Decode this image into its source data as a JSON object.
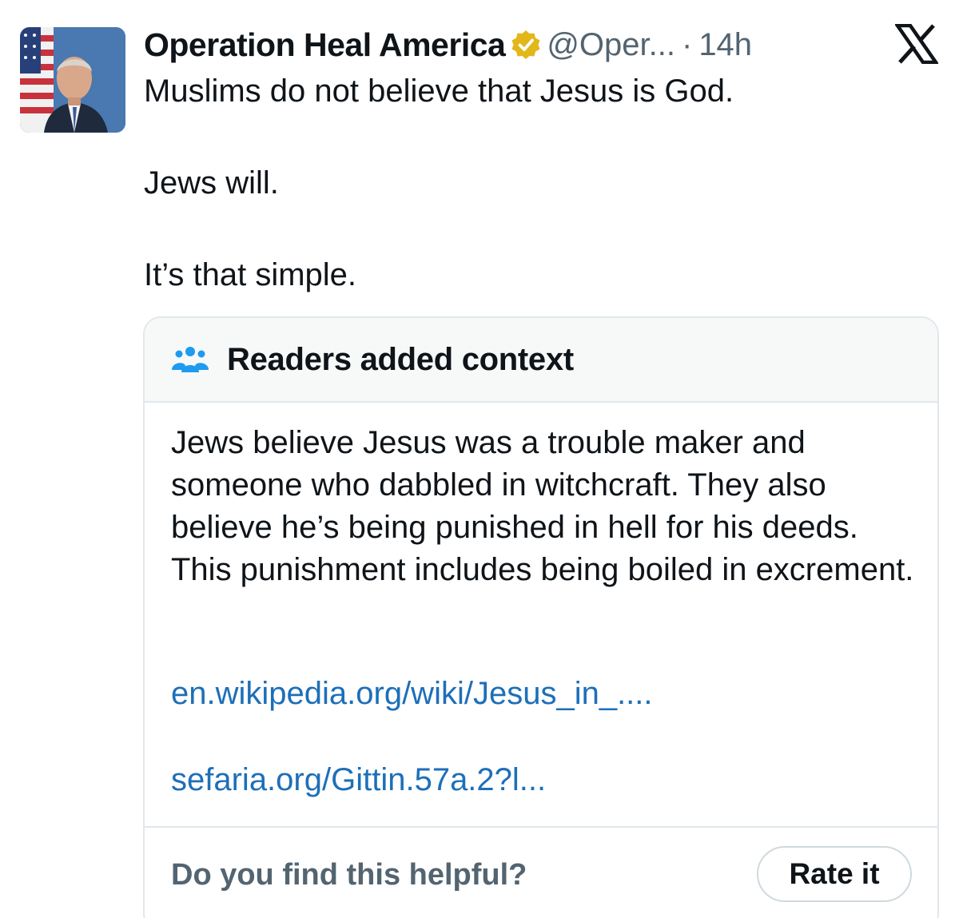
{
  "tweet": {
    "display_name": "Operation Heal America",
    "handle": "@Oper...",
    "separator": "·",
    "time": "14h",
    "lines": [
      "Muslims do not believe that Jesus is God.",
      "Jews will.",
      "It’s that simple."
    ]
  },
  "note": {
    "title": "Readers added context",
    "body": "Jews believe Jesus was a trouble maker and someone who dabbled in witchcraft. They also believe he’s being punished in hell for his deeds. This punishment includes being boiled in excrement.",
    "links": [
      "en.wikipedia.org/wiki/Jesus_in_....",
      "sefaria.org/Gittin.57a.2?l..."
    ],
    "helpful_question": "Do you find this helpful?",
    "rate_label": "Rate it"
  },
  "colors": {
    "text": "#0f1419",
    "secondary": "#536471",
    "link": "#1d6fb8",
    "verified_gold": "#e2b719",
    "note_icon_blue": "#1d9bf0",
    "border": "#e1e8ed"
  },
  "icons": [
    "avatar",
    "verified-badge-icon",
    "x-logo-icon",
    "people-icon"
  ]
}
